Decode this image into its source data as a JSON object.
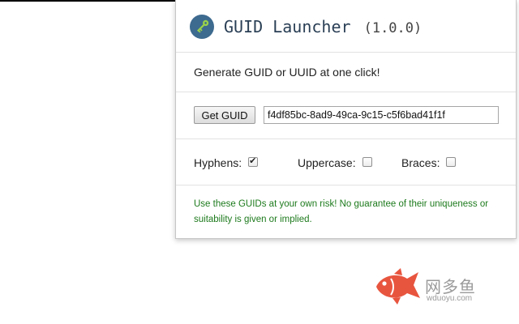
{
  "app": {
    "title": "GUID Launcher",
    "version": "(1.0.0)",
    "logo_icon": "key-icon",
    "logo_color": "#3d6a8f"
  },
  "tagline": "Generate GUID or UUID at one click!",
  "generator": {
    "button_label": "Get GUID",
    "guid_value": "f4df85bc-8ad9-49ca-9c15-c5f6bad41f1f"
  },
  "options": [
    {
      "label": "Hyphens:",
      "checked": true
    },
    {
      "label": "Uppercase:",
      "checked": false
    },
    {
      "label": "Braces:",
      "checked": false
    }
  ],
  "disclaimer": "Use these GUIDs at your own risk! No guarantee of their uniqueness or suitability is given or implied.",
  "watermark": {
    "chinese": "网多鱼",
    "domain": "wduoyu.com",
    "fish_icon": "fish-icon",
    "fish_color": "#e8553f"
  },
  "colors": {
    "disclaimer_text": "#1d7a1d",
    "title_text": "#2a3f55"
  }
}
